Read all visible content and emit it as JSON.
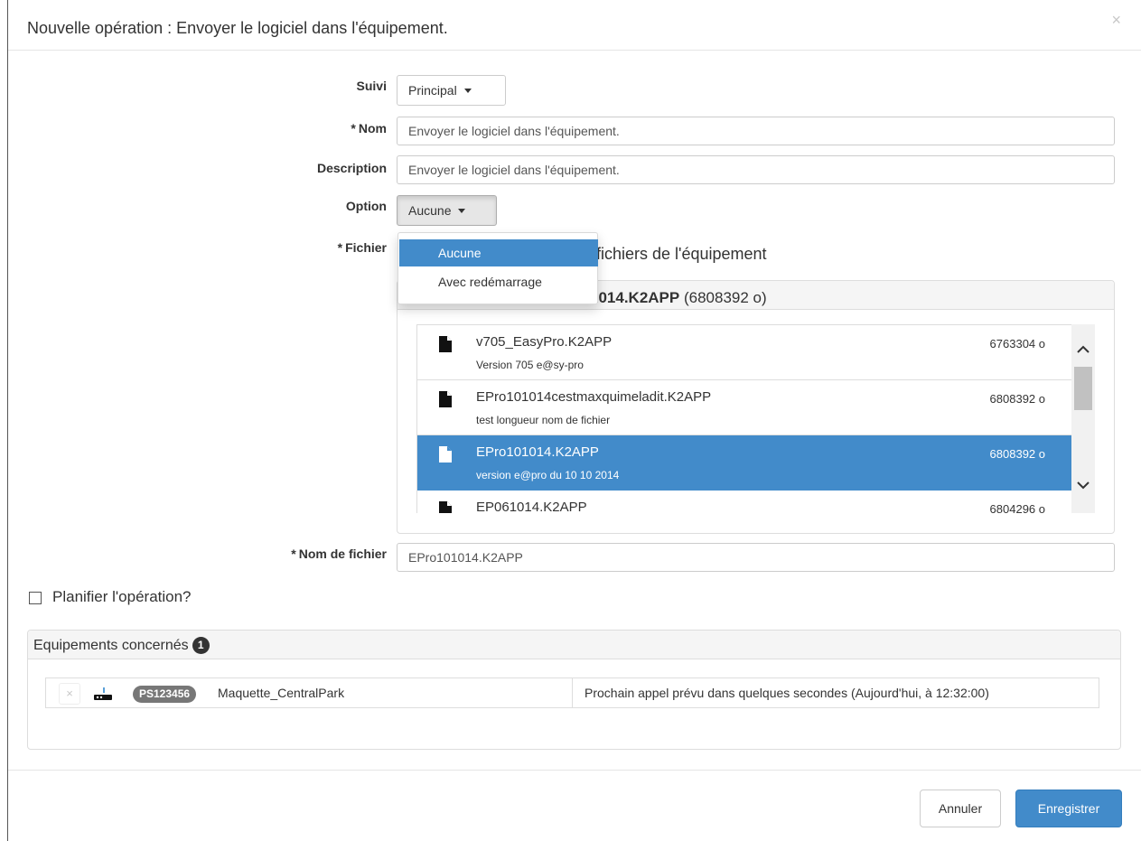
{
  "modal": {
    "title": "Nouvelle opération : Envoyer le logiciel dans l'équipement.",
    "close_glyph": "×"
  },
  "form": {
    "suivi": {
      "label": "Suivi",
      "value": "Principal"
    },
    "nom": {
      "label": "Nom",
      "required_mark": "*",
      "value": "Envoyer le logiciel dans l'équipement."
    },
    "description": {
      "label": "Description",
      "value": "Envoyer le logiciel dans l'équipement."
    },
    "option": {
      "label": "Option",
      "value": "Aucune",
      "menu_open": true,
      "items": [
        {
          "label": "Aucune",
          "active": true
        },
        {
          "label": "Avec redémarrage",
          "active": false
        }
      ]
    },
    "fichier": {
      "label": "Fichier",
      "required_mark": "*",
      "heading_visible": "fichiers de l'équipement",
      "selected_visible_name": "1014.K2APP",
      "selected_size": "(6808392 o)",
      "files": [
        {
          "name": "v705_EasyPro.K2APP",
          "description": "Version 705 e@sy-pro",
          "size": "6763304 o",
          "selected": false,
          "icon": "file-icon"
        },
        {
          "name": "EPro101014cestmaxquimeladit.K2APP",
          "description": "test longueur nom de fichier",
          "size": "6808392 o",
          "selected": false,
          "icon": "file-icon"
        },
        {
          "name": "EPro101014.K2APP",
          "description": "version e@pro du 10 10 2014",
          "size": "6808392 o",
          "selected": true,
          "icon": "file-icon"
        },
        {
          "name": "EP061014.K2APP",
          "description": "",
          "size": "6804296 o",
          "selected": false,
          "icon": "file-icon"
        }
      ]
    },
    "nom_fichier": {
      "label": "Nom de fichier",
      "required_mark": "*",
      "value": "EPro101014.K2APP"
    },
    "planifier": {
      "label": "Planifier l'opération?",
      "checked": false
    }
  },
  "equipements": {
    "title": "Equipements concernés",
    "count": "1",
    "rows": [
      {
        "remove_glyph": "×",
        "icon": "device-icon",
        "serial": "PS123456",
        "name": "Maquette_CentralPark",
        "status": "Prochain appel prévu dans quelques secondes (Aujourd'hui, à 12:32:00)"
      }
    ]
  },
  "footer": {
    "cancel_label": "Annuler",
    "save_label": "Enregistrer"
  },
  "colors": {
    "primary": "#428bca",
    "selected_row": "#428bca",
    "badge_dark": "#333333",
    "badge_grey": "#777777"
  }
}
